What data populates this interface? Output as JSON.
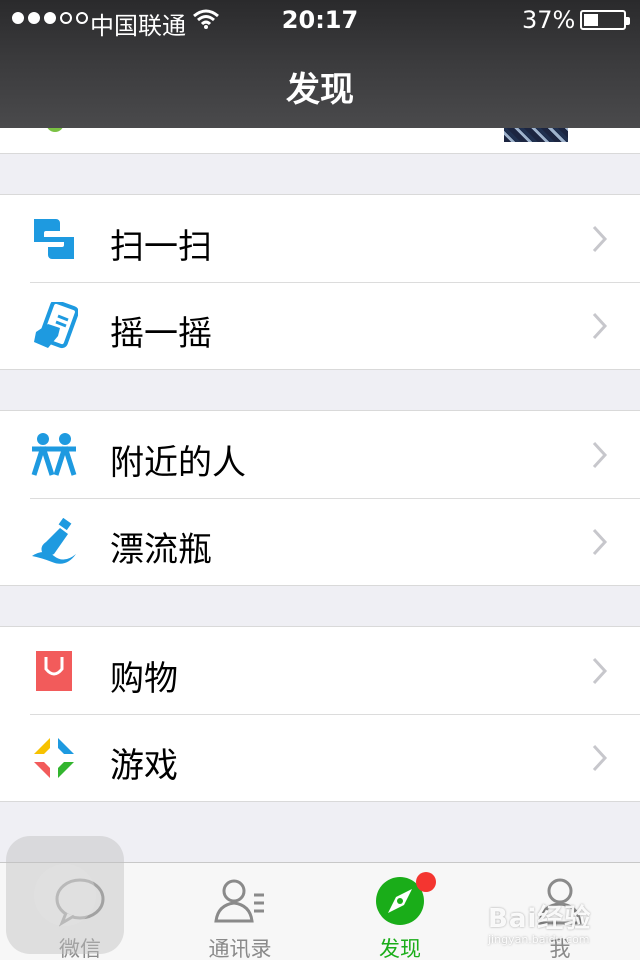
{
  "status": {
    "signal_dots_filled": 3,
    "signal_dots_total": 5,
    "carrier": "中国联通",
    "time": "20:17",
    "battery_percent": "37%",
    "battery_level": 0.37
  },
  "nav": {
    "title": "发现"
  },
  "groups": [
    {
      "items": [
        {
          "label": "扫一扫",
          "icon": "scan-icon"
        },
        {
          "label": "摇一摇",
          "icon": "shake-phone-icon"
        }
      ]
    },
    {
      "items": [
        {
          "label": "附近的人",
          "icon": "people-nearby-icon"
        },
        {
          "label": "漂流瓶",
          "icon": "drift-bottle-icon"
        }
      ]
    },
    {
      "items": [
        {
          "label": "购物",
          "icon": "shopping-bag-icon"
        },
        {
          "label": "游戏",
          "icon": "games-icon"
        }
      ]
    }
  ],
  "tabs": [
    {
      "label": "微信",
      "icon": "chat-bubble-icon",
      "active": false
    },
    {
      "label": "通讯录",
      "icon": "contacts-icon",
      "active": false
    },
    {
      "label": "发现",
      "icon": "compass-icon",
      "active": true
    },
    {
      "label": "我",
      "icon": "me-icon",
      "active": false
    }
  ],
  "colors": {
    "accent_green": "#1aad19",
    "icon_blue": "#1e9ae0",
    "shopping_red": "#f25b5b",
    "badge_red": "#f43530"
  },
  "watermark": {
    "main": "Bai经验",
    "sub": "jingyan.baidu.com"
  }
}
